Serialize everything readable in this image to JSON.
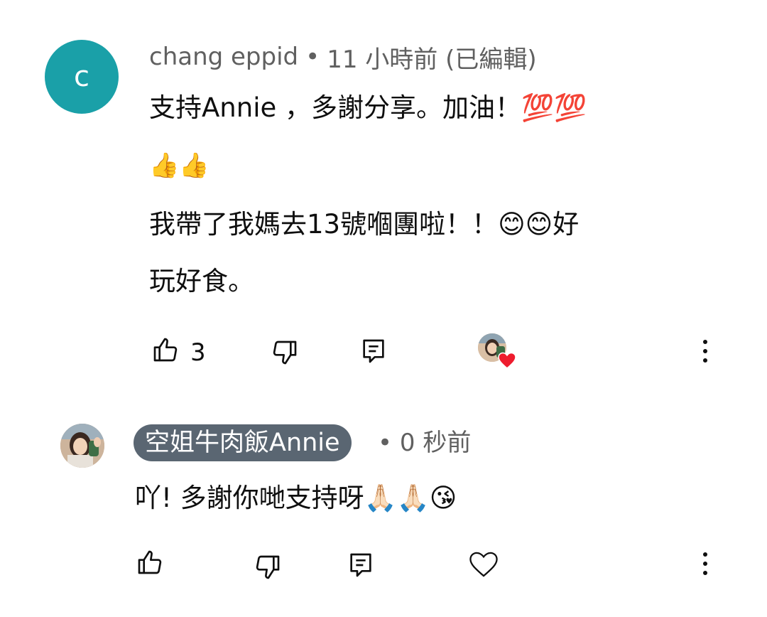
{
  "comment1": {
    "avatar_letter": "c",
    "avatar_color": "#1aa0a8",
    "author": "chang eppid",
    "separator": "•",
    "time": "11 小時前 (已編輯)",
    "text_line1": "支持Annie ，多謝分享。加油！💯💯",
    "text_line2": "👍👍",
    "text_line3": "我帶了我媽去13號嗰團啦！！😊😊好",
    "text_line4": "玩好食。",
    "like_count": "3",
    "creator_heart": true
  },
  "comment2": {
    "author": "空姐牛肉飯Annie",
    "separator": "•",
    "time": "0 秒前",
    "text": "吖!  多謝你哋支持呀🙏🏻🙏🏻😘",
    "author_chip_color": "#5a6672"
  },
  "colors": {
    "heart_red": "#ee1c2e",
    "meta_gray": "#606060",
    "text": "#0f0f0f"
  }
}
